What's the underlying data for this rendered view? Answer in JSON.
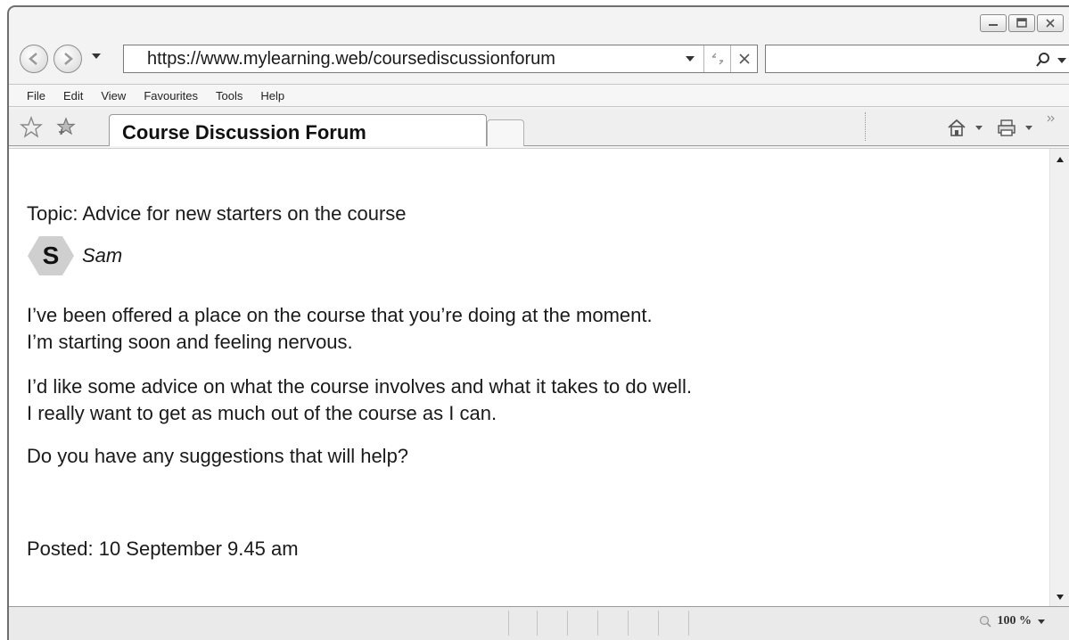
{
  "browser": {
    "url": "https://www.mylearning.web/coursediscussionforum",
    "menu": [
      "File",
      "Edit",
      "View",
      "Favourites",
      "Tools",
      "Help"
    ],
    "tab_title": "Course Discussion Forum",
    "zoom": "100 %"
  },
  "post": {
    "topic": "Topic: Advice for new starters on the course",
    "avatar_letter": "S",
    "author": "Sam",
    "paragraph1_line1": "I’ve been offered a place on the course that you’re doing at the moment.",
    "paragraph1_line2": "I’m starting soon and feeling nervous.",
    "paragraph2_line1": "I’d like some advice on what the course involves and what it takes to do well.",
    "paragraph2_line2": "I really want to get as much out of the course as I can.",
    "paragraph3": "Do you have any suggestions that will help?",
    "posted": "Posted: 10 September 9.45 am"
  },
  "icons": [
    "back-icon",
    "forward-icon",
    "refresh-icon",
    "stop-icon",
    "search-icon",
    "favorites-star-icon",
    "add-favorites-icon",
    "home-icon",
    "print-icon",
    "zoom-icon"
  ]
}
